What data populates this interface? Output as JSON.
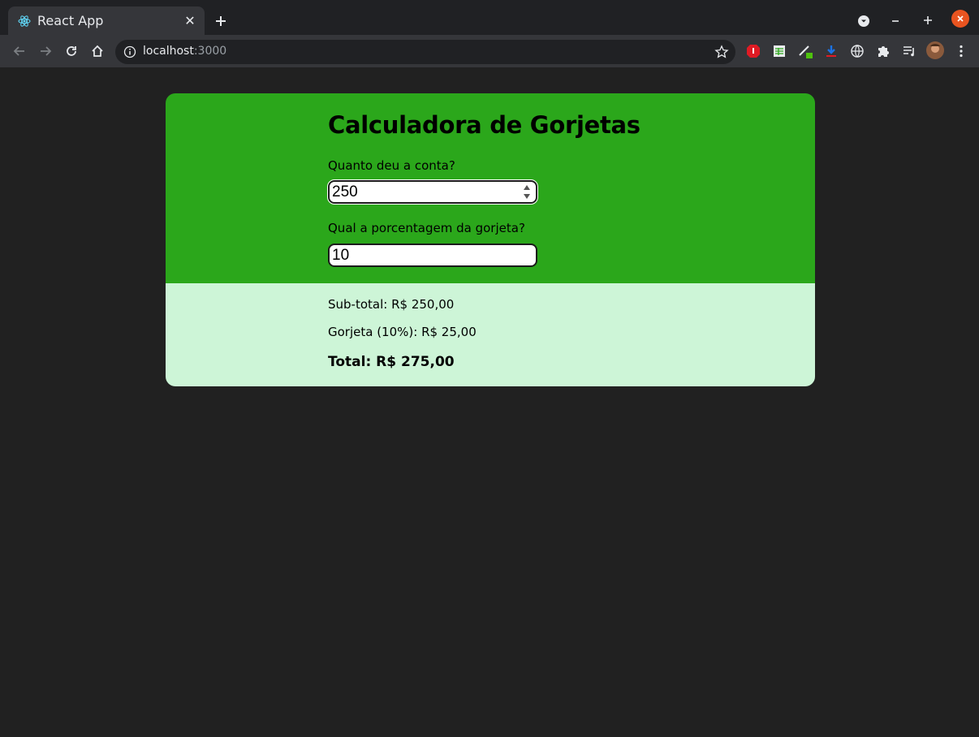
{
  "browser": {
    "tab_title": "React App",
    "url_host": "localhost",
    "url_port": ":3000"
  },
  "app": {
    "title": "Calculadora de Gorjetas",
    "bill_label": "Quanto deu a conta?",
    "bill_value": "250",
    "tip_label": "Qual a porcentagem da gorjeta?",
    "tip_value": "10",
    "subtotal_text": "Sub-total: R$ 250,00",
    "tip_text": "Gorjeta (10%): R$ 25,00",
    "total_text": "Total: R$ 275,00"
  },
  "colors": {
    "header_green": "#2ba71b",
    "results_mint": "#cdf5d7",
    "page_bg": "#212121"
  }
}
